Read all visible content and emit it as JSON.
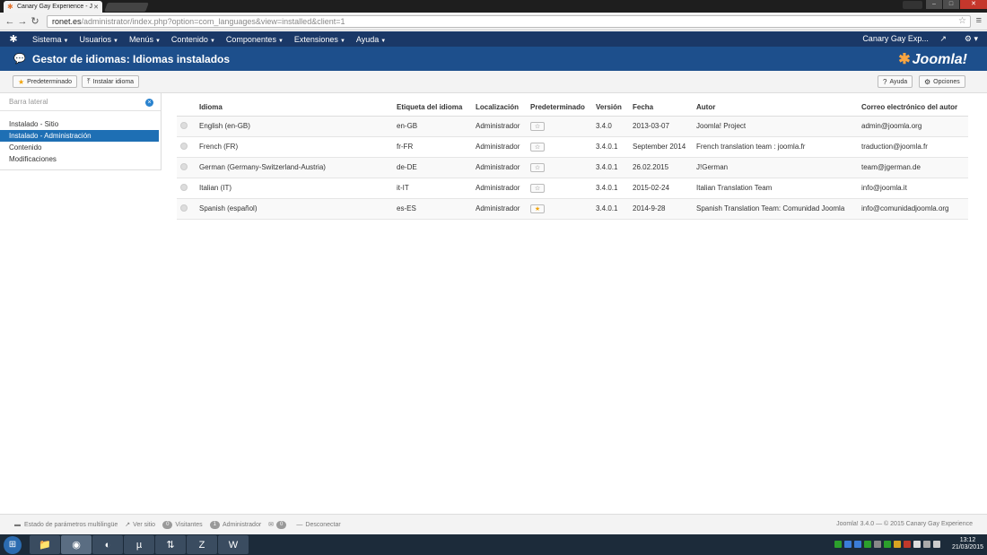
{
  "browser": {
    "tab_title": "Canary Gay Experience - J",
    "tab_close": "✕",
    "url_host": "ronet.es",
    "url_path": "/administrator/index.php?option=com_languages&view=installed&client=1"
  },
  "topnav": {
    "items": [
      "Sistema",
      "Usuarios",
      "Menús",
      "Contenido",
      "Componentes",
      "Extensiones",
      "Ayuda"
    ],
    "site_name": "Canary Gay Exp..."
  },
  "header": {
    "title": "Gestor de idiomas: Idiomas instalados",
    "brand": "Joomla!"
  },
  "toolbar": {
    "default_label": "Predeterminado",
    "install_label": "Instalar idioma",
    "help_label": "Ayuda",
    "options_label": "Opciones"
  },
  "sidebar": {
    "title": "Barra lateral",
    "items": [
      {
        "label": "Instalado - Sitio"
      },
      {
        "label": "Instalado - Administración"
      },
      {
        "label": "Contenido"
      },
      {
        "label": "Modificaciones"
      }
    ]
  },
  "table": {
    "headers": [
      "Idioma",
      "Etiqueta del idioma",
      "Localización",
      "Predeterminado",
      "Versión",
      "Fecha",
      "Autor",
      "Correo electrónico del autor"
    ],
    "rows": [
      {
        "language": "English (en-GB)",
        "tag": "en-GB",
        "location": "Administrador",
        "default": false,
        "version": "3.4.0",
        "date": "2013-03-07",
        "author": "Joomla! Project",
        "email": "admin@joomla.org"
      },
      {
        "language": "French (FR)",
        "tag": "fr-FR",
        "location": "Administrador",
        "default": false,
        "version": "3.4.0.1",
        "date": "September 2014",
        "author": "French translation team : joomla.fr",
        "email": "traduction@joomla.fr"
      },
      {
        "language": "German (Germany-Switzerland-Austria)",
        "tag": "de-DE",
        "location": "Administrador",
        "default": false,
        "version": "3.4.0.1",
        "date": "26.02.2015",
        "author": "J!German",
        "email": "team@jgerman.de"
      },
      {
        "language": "Italian (IT)",
        "tag": "it-IT",
        "location": "Administrador",
        "default": false,
        "version": "3.4.0.1",
        "date": "2015-02-24",
        "author": "Italian Translation Team",
        "email": "info@joomla.it"
      },
      {
        "language": "Spanish (español)",
        "tag": "es-ES",
        "location": "Administrador",
        "default": true,
        "version": "3.4.0.1",
        "date": "2014-9-28",
        "author": "Spanish Translation Team: Comunidad Joomla",
        "email": "info@comunidadjoomla.org"
      }
    ]
  },
  "status": {
    "multilang": "Estado de parámetros multilingüe",
    "view_site": "Ver sitio",
    "visitors_count": "0",
    "visitors_label": "Visitantes",
    "admins_count": "1",
    "admins_label": "Administrador",
    "messages_count": "0",
    "logout": "Desconectar",
    "copyright": "Joomla! 3.4.0 — © 2015 Canary Gay Experience"
  },
  "taskbar": {
    "time": "13:12",
    "date": "21/03/2015"
  },
  "colors": {
    "nav_bg": "#1a3867",
    "header_bg": "#1d4f8c",
    "active_item": "#1e6fb4",
    "star_on": "#f0a30a"
  }
}
